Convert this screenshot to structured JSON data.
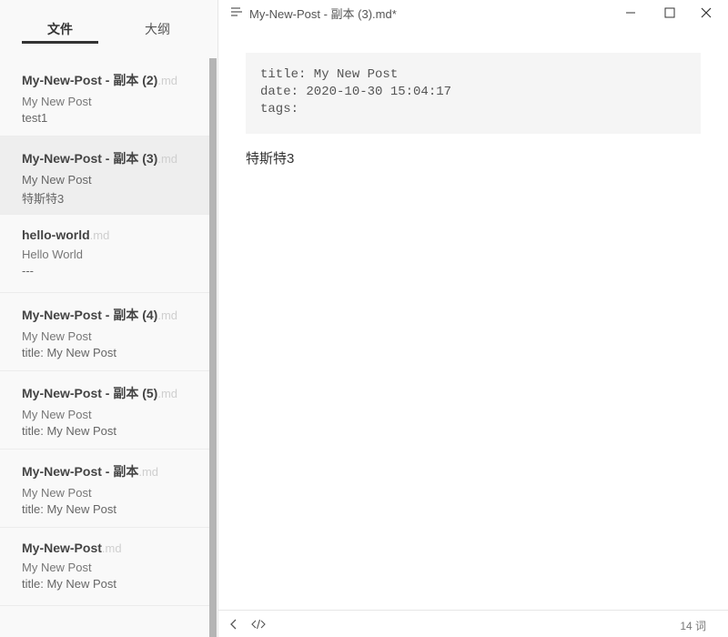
{
  "sidebar": {
    "tabs": {
      "files": "文件",
      "outline": "大纲"
    },
    "files": [
      {
        "name": "My-New-Post - 副本 (2)",
        "ext": ".md",
        "line1": "My New Post",
        "line2": "test1"
      },
      {
        "name": "My-New-Post - 副本 (3)",
        "ext": ".md",
        "line1": "My New Post",
        "line2": "特斯特3"
      },
      {
        "name": "hello-world",
        "ext": ".md",
        "line1": "Hello World",
        "line2": "---"
      },
      {
        "name": "My-New-Post - 副本 (4)",
        "ext": ".md",
        "line1": "My New Post",
        "line2": "title: My New Post"
      },
      {
        "name": "My-New-Post - 副本 (5)",
        "ext": ".md",
        "line1": "My New Post",
        "line2": "title: My New Post"
      },
      {
        "name": "My-New-Post - 副本",
        "ext": ".md",
        "line1": "My New Post",
        "line2": "title: My New Post"
      },
      {
        "name": "My-New-Post",
        "ext": ".md",
        "line1": "My New Post",
        "line2": "title: My New Post"
      }
    ]
  },
  "titlebar": {
    "title": "My-New-Post - 副本 (3).md*"
  },
  "editor": {
    "front_matter": {
      "line1": "title: My New Post",
      "line2": "date: 2020-10-30 15:04:17",
      "line3": "tags:"
    },
    "body": "特斯特3"
  },
  "statusbar": {
    "word_count": "14 词"
  }
}
